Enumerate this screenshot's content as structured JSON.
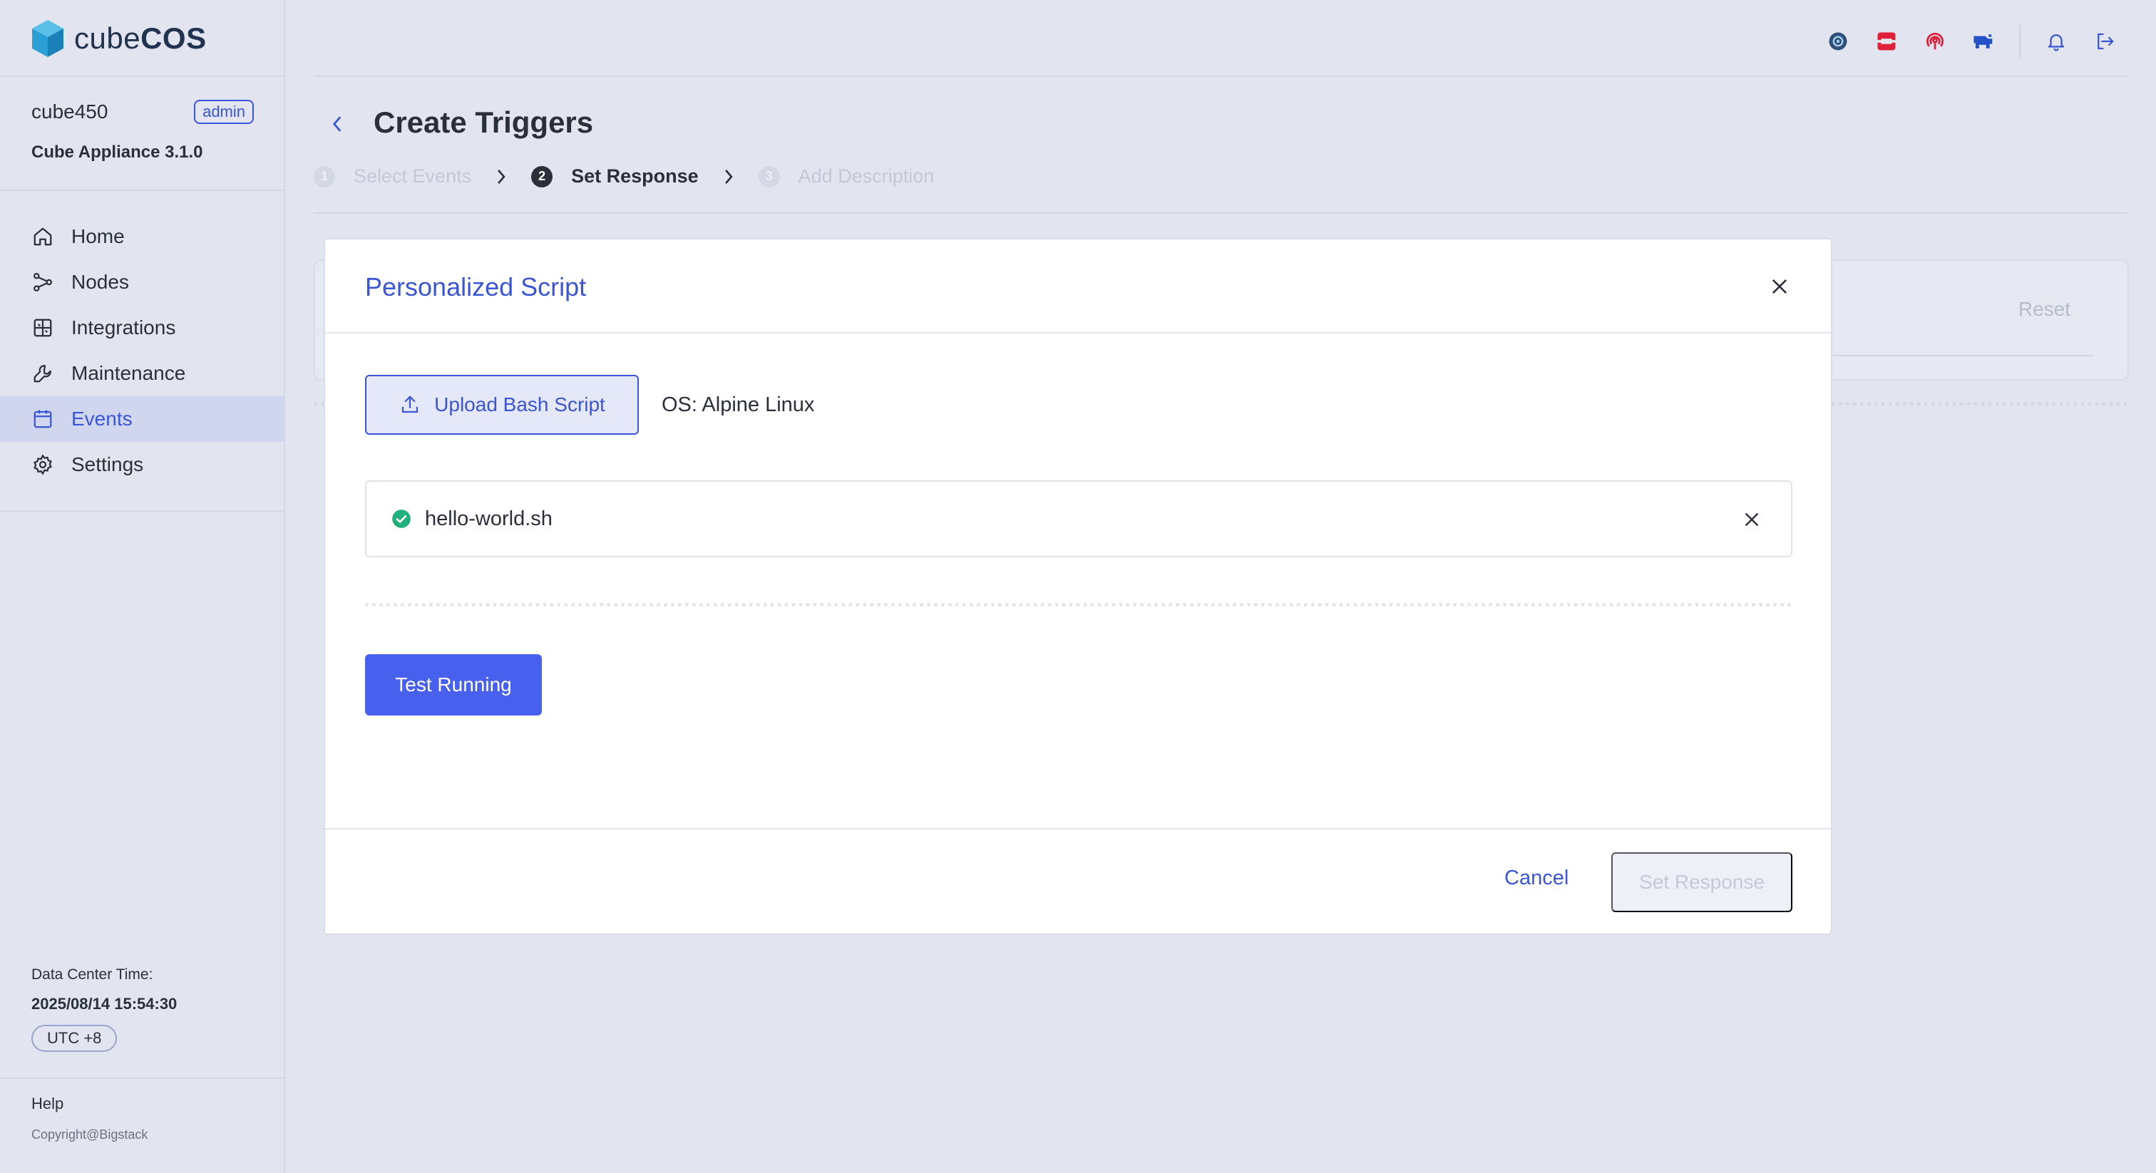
{
  "app": {
    "brand_light": "cube",
    "brand_bold": "COS"
  },
  "user": {
    "name": "cube450",
    "role_badge": "admin",
    "appliance": "Cube Appliance 3.1.0"
  },
  "sidebar": {
    "items": [
      {
        "label": "Home",
        "icon": "home-icon"
      },
      {
        "label": "Nodes",
        "icon": "nodes-icon"
      },
      {
        "label": "Integrations",
        "icon": "integrations-icon"
      },
      {
        "label": "Maintenance",
        "icon": "wrench-icon"
      },
      {
        "label": "Events",
        "icon": "calendar-icon",
        "active": true
      },
      {
        "label": "Settings",
        "icon": "gear-icon"
      }
    ],
    "dc_time_label": "Data Center Time:",
    "dc_time_value": "2025/08/14 15:54:30",
    "timezone": "UTC +8",
    "help": "Help",
    "copyright": "Copyright@Bigstack"
  },
  "topbar": {
    "icons": [
      "ceph-icon",
      "openstack-icon",
      "podcast-icon",
      "rancher-icon",
      "bell-icon",
      "logout-icon"
    ]
  },
  "page": {
    "title": "Create Triggers",
    "steps": [
      {
        "num": "1",
        "label": "Select Events",
        "state": "inactive"
      },
      {
        "num": "2",
        "label": "Set Response",
        "state": "current"
      },
      {
        "num": "3",
        "label": "Add Description",
        "state": "inactive"
      }
    ],
    "reset_label": "Reset"
  },
  "modal": {
    "title": "Personalized Script",
    "upload_label": "Upload Bash Script",
    "os_label": "OS: Alpine Linux",
    "file_name": "hello-world.sh",
    "test_label": "Test Running",
    "cancel_label": "Cancel",
    "submit_label": "Set Response"
  },
  "colors": {
    "accent": "#3a55d6",
    "primary_button": "#4860ee",
    "success": "#22b07d",
    "background": "#e2e5ef"
  }
}
